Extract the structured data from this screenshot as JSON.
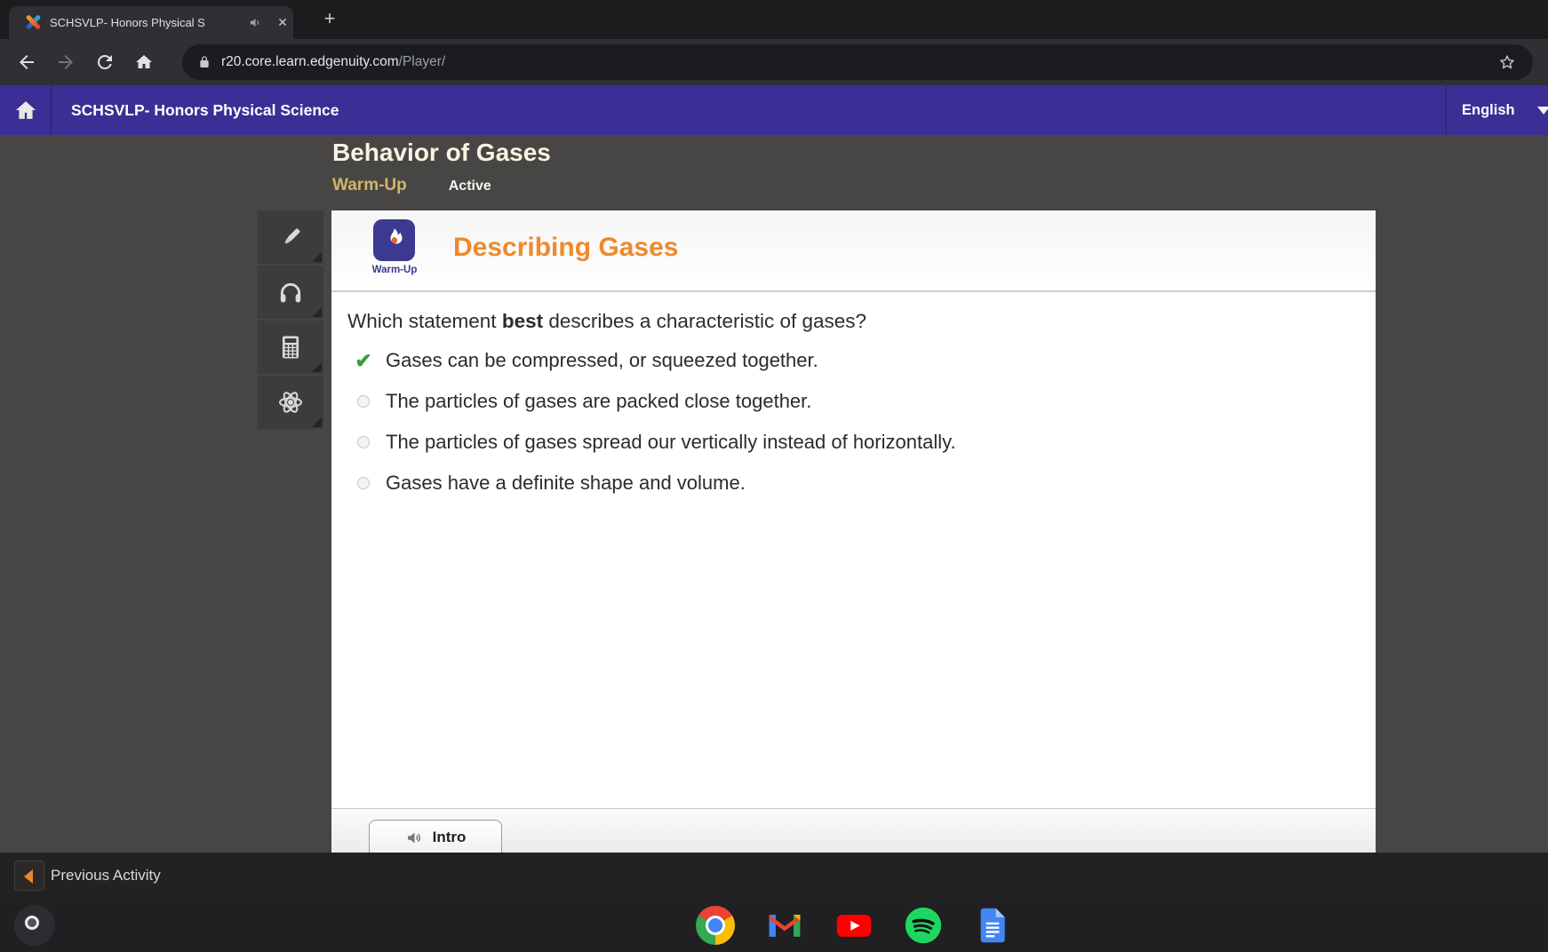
{
  "browser": {
    "tab_title": "SCHSVLP- Honors Physical S",
    "close_label": "✕",
    "new_tab_label": "+",
    "url_domain": "r20.core.learn.edgenuity.com",
    "url_path": "/Player/"
  },
  "appbar": {
    "course_title": "SCHSVLP- Honors Physical Science",
    "language_label": "English"
  },
  "lesson": {
    "title": "Behavior of Gases",
    "tab_warmup": "Warm-Up",
    "tab_active": "Active"
  },
  "sidebar": {
    "tools": [
      {
        "name": "highlighter-icon"
      },
      {
        "name": "headphones-icon"
      },
      {
        "name": "calculator-icon"
      },
      {
        "name": "atom-icon"
      }
    ]
  },
  "activity": {
    "badge_label": "Warm-Up",
    "heading": "Describing Gases",
    "question": {
      "prefix": "Which statement ",
      "bold": "best",
      "suffix": " describes a characteristic of gases?"
    },
    "check_glyph": "✔",
    "options": [
      {
        "text": "Gases can be compressed, or squeezed together.",
        "state": "selected-correct"
      },
      {
        "text": "The particles of gases are packed close together.",
        "state": "unselected"
      },
      {
        "text": "The particles of gases spread our vertically instead of horizontally.",
        "state": "unselected"
      },
      {
        "text": "Gases have a definite shape and volume.",
        "state": "unselected"
      }
    ],
    "intro_button_label": "Intro"
  },
  "footer": {
    "previous_label": "Previous Activity"
  },
  "shelf": {
    "apps": [
      "chrome",
      "gmail",
      "youtube",
      "spotify",
      "google-docs"
    ]
  },
  "colors": {
    "header_purple": "#3b2e95",
    "heading_orange": "#ee8a2b",
    "warmup_tab_gold": "#d2b56a",
    "check_green": "#3e9d40",
    "content_background": "#484644"
  }
}
